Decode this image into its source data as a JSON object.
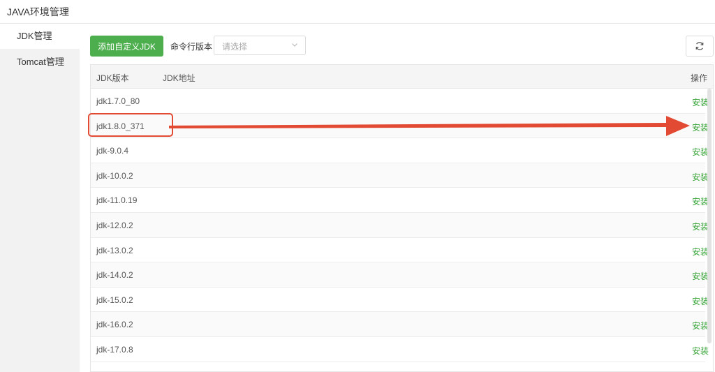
{
  "app": {
    "title": "JAVA环境管理"
  },
  "sidebar": {
    "items": [
      {
        "label": "JDK管理",
        "active": true
      },
      {
        "label": "Tomcat管理",
        "active": false
      }
    ]
  },
  "toolbar": {
    "add_button": "添加自定义JDK",
    "cli_label": "命令行版本",
    "select_placeholder": "请选择",
    "refresh_icon": "refresh-icon"
  },
  "table": {
    "headers": {
      "version": "JDK版本",
      "path": "JDK地址",
      "action": "操作"
    },
    "rows": [
      {
        "version": "jdk1.7.0_80",
        "path": "",
        "action": "安装"
      },
      {
        "version": "jdk1.8.0_371",
        "path": "",
        "action": "安装"
      },
      {
        "version": "jdk-9.0.4",
        "path": "",
        "action": "安装"
      },
      {
        "version": "jdk-10.0.2",
        "path": "",
        "action": "安装"
      },
      {
        "version": "jdk-11.0.19",
        "path": "",
        "action": "安装"
      },
      {
        "version": "jdk-12.0.2",
        "path": "",
        "action": "安装"
      },
      {
        "version": "jdk-13.0.2",
        "path": "",
        "action": "安装"
      },
      {
        "version": "jdk-14.0.2",
        "path": "",
        "action": "安装"
      },
      {
        "version": "jdk-15.0.2",
        "path": "",
        "action": "安装"
      },
      {
        "version": "jdk-16.0.2",
        "path": "",
        "action": "安装"
      },
      {
        "version": "jdk-17.0.8",
        "path": "",
        "action": "安装"
      }
    ]
  },
  "colors": {
    "accent_green": "#4cae4c",
    "action_green": "#3aa53a",
    "annotation_red": "#e24a33"
  }
}
